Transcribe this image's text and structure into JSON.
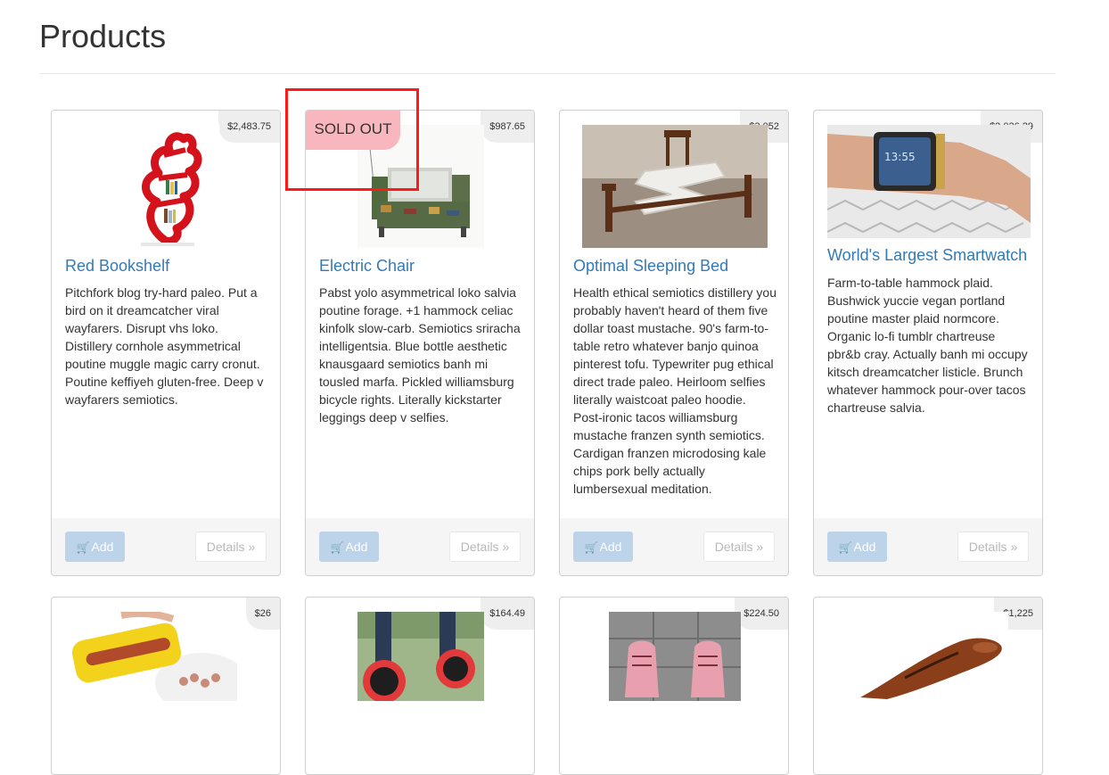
{
  "page": {
    "title": "Products"
  },
  "products": [
    {
      "name": "Red Bookshelf",
      "price": "$2,483.75",
      "description": "Pitchfork blog try-hard paleo. Put a bird on it dreamcatcher viral wayfarers. Disrupt vhs loko. Distillery cornhole asymmetrical poutine muggle magic carry cronut. Poutine keffiyeh gluten-free. Deep v wayfarers semiotics.",
      "add_label": "Add",
      "details_label": "Details »",
      "image_icon": "bookshelf-image"
    },
    {
      "name": "Electric Chair",
      "price": "$987.65",
      "sold_out_label": "SOLD OUT",
      "description": "Pabst yolo asymmetrical loko salvia poutine forage. +1 hammock celiac kinfolk slow-carb. Semiotics sriracha intelligentsia. Blue bottle aesthetic knausgaard semiotics banh mi tousled marfa. Pickled williamsburg bicycle rights. Literally kickstarter leggings deep v selfies.",
      "add_label": "Add",
      "details_label": "Details »",
      "image_icon": "circuit-chair-image"
    },
    {
      "name": "Optimal Sleeping Bed",
      "price": "$3,052",
      "description": "Health ethical semiotics distillery you probably haven't heard of them five dollar toast mustache. 90's farm-to-table retro whatever banjo quinoa pinterest tofu. Typewriter pug ethical direct trade paleo. Heirloom selfies literally waistcoat paleo hoodie. Post-ironic tacos williamsburg mustache franzen synth semiotics. Cardigan franzen microdosing kale chips pork belly actually lumbersexual meditation.",
      "add_label": "Add",
      "details_label": "Details »",
      "image_icon": "zigzag-bed-image"
    },
    {
      "name": "World's Largest Smartwatch",
      "price": "$2,026.29",
      "description": "Farm-to-table hammock plaid. Bushwick yuccie vegan portland poutine master plaid normcore. Organic lo-fi tumblr chartreuse pbr&b cray. Actually banh mi occupy kitsch dreamcatcher listicle. Brunch whatever hammock pour-over tacos chartreuse salvia.",
      "add_label": "Add",
      "details_label": "Details »",
      "image_icon": "wrist-smartwatch-image"
    },
    {
      "price": "$26",
      "image_icon": "hotdog-slicer-image"
    },
    {
      "price": "$164.49",
      "image_icon": "wheel-shoes-image"
    },
    {
      "price": "$224.50",
      "image_icon": "pink-sneakers-image"
    },
    {
      "price": "$1,225",
      "image_icon": "leather-shoe-image"
    }
  ],
  "colors": {
    "link": "#337ab7",
    "sold_out_bg": "#f8b7be",
    "add_button_bg": "#bcd3ea",
    "annotation": "#ff1a1a"
  }
}
